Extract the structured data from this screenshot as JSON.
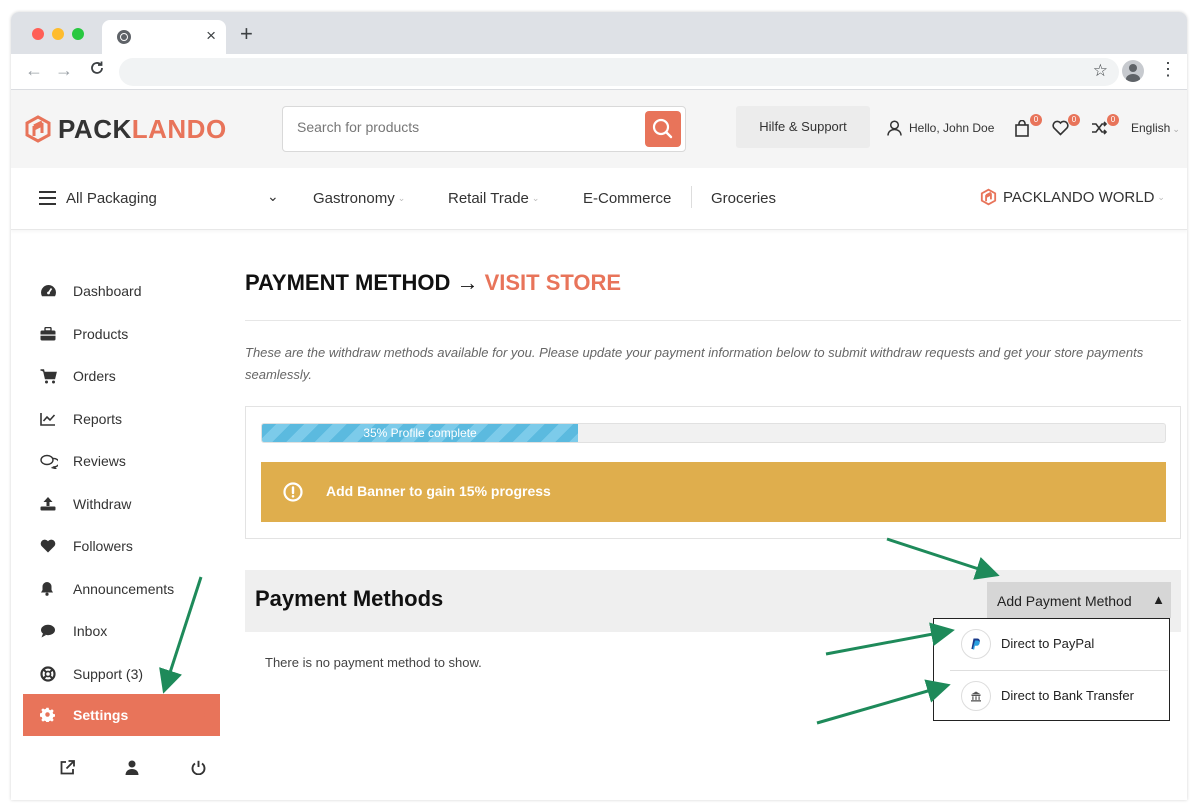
{
  "browser": {
    "tab_close": "×",
    "new_tab": "+",
    "back": "←",
    "forward": "→",
    "reload": "C",
    "bookmark_star": "☆",
    "menu_dots": "⋮"
  },
  "header": {
    "logo_part1": "PACK",
    "logo_part2": "LANDO",
    "search_placeholder": "Search for products",
    "help_label": "Hilfe & Support",
    "user_greeting": "Hello, John Doe",
    "cart_count": "0",
    "wishlist_count": "0",
    "compare_count": "0",
    "language": "English"
  },
  "navbar": {
    "all_packaging": "All Packaging",
    "chevron": "⌄",
    "items": [
      {
        "label": "Gastronomy",
        "dropdown": true
      },
      {
        "label": "Retail Trade",
        "dropdown": true
      },
      {
        "label": "E-Commerce",
        "dropdown": false
      },
      {
        "label": "Groceries",
        "dropdown": false
      }
    ],
    "world": "PACKLANDO WORLD",
    "small_chevron": "⌄"
  },
  "sidebar": {
    "items": [
      {
        "label": "Dashboard",
        "icon": "dashboard-icon"
      },
      {
        "label": "Products",
        "icon": "briefcase-icon"
      },
      {
        "label": "Orders",
        "icon": "cart-icon"
      },
      {
        "label": "Reports",
        "icon": "line-chart-icon"
      },
      {
        "label": "Reviews",
        "icon": "comments-icon"
      },
      {
        "label": "Withdraw",
        "icon": "upload-icon"
      },
      {
        "label": "Followers",
        "icon": "heart-icon"
      },
      {
        "label": "Announcements",
        "icon": "bell-icon"
      },
      {
        "label": "Inbox",
        "icon": "chat-bubble-icon"
      },
      {
        "label": "Support (3)",
        "icon": "lifebuoy-icon"
      }
    ],
    "active": {
      "label": "Settings",
      "icon": "gear-icon"
    }
  },
  "main": {
    "title_part1": "PAYMENT METHOD →",
    "title_part2": "VISIT STORE",
    "description": "These are the withdraw methods available for you. Please update your payment information below to submit withdraw requests and get your store payments seamlessly.",
    "progress_label": "35% Profile complete",
    "progress_value": 35,
    "banner_text": "Add Banner to gain 15% progress",
    "payment_methods_title": "Payment Methods",
    "add_payment_label": "Add Payment Method",
    "add_payment_arrow": "▲",
    "empty_message": "There is no payment method to show.",
    "dropdown_items": [
      {
        "label": "Direct to PayPal",
        "icon": "paypal-icon"
      },
      {
        "label": "Direct to Bank Transfer",
        "icon": "bank-icon"
      }
    ]
  },
  "colors": {
    "brand": "#e8745a",
    "banner": "#dfae4d",
    "progress": "#5bbadf",
    "annotation": "#1e8a5a"
  }
}
